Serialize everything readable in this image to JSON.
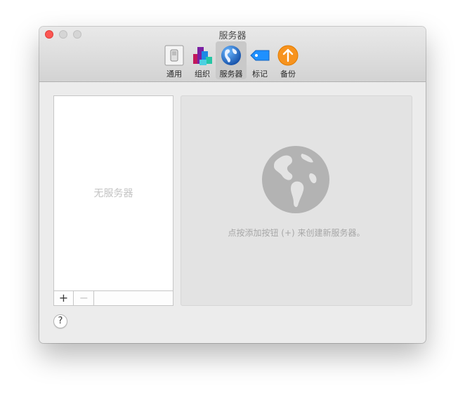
{
  "window": {
    "title": "服务器"
  },
  "toolbar": {
    "items": [
      {
        "label": "通用",
        "icon": "general-switch-icon",
        "selected": false
      },
      {
        "label": "组织",
        "icon": "organize-blocks-icon",
        "selected": false
      },
      {
        "label": "服务器",
        "icon": "globe-icon",
        "selected": true
      },
      {
        "label": "标记",
        "icon": "tag-icon",
        "selected": false
      },
      {
        "label": "备份",
        "icon": "backup-arrow-icon",
        "selected": false
      }
    ]
  },
  "server_list": {
    "empty_text": "无服务器",
    "add_label": "+",
    "remove_label": "−"
  },
  "detail": {
    "hint": "点按添加按钮 (+) 来创建新服务器。"
  },
  "help": {
    "label": "?"
  },
  "colors": {
    "close_button": "#fc5753",
    "selected_toolbar_bg": "#c9c9c9",
    "backup_orange": "#f7931e",
    "tag_blue": "#1e90ff"
  }
}
